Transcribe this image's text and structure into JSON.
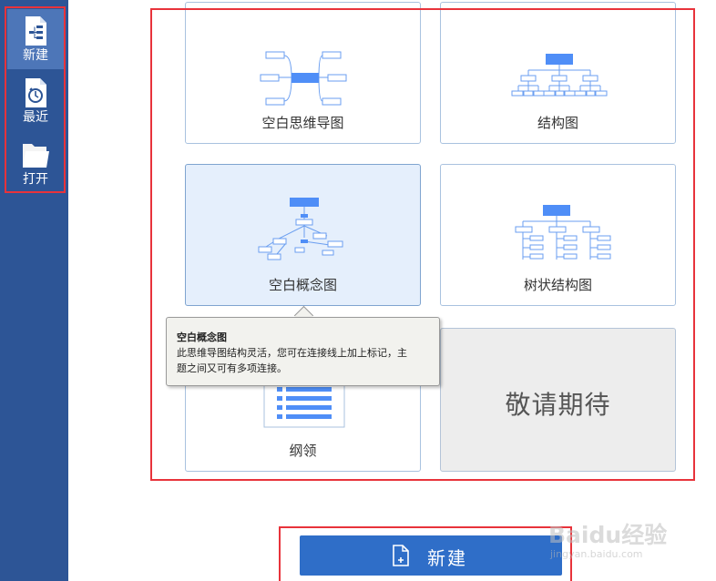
{
  "sidebar": {
    "items": [
      {
        "label": "新建",
        "icon": "new-file-icon"
      },
      {
        "label": "最近",
        "icon": "recent-clock-icon"
      },
      {
        "label": "打开",
        "icon": "open-folder-icon"
      }
    ]
  },
  "templates": [
    {
      "label": "空白思维导图",
      "icon": "mind-map-thumbnail"
    },
    {
      "label": "结构图",
      "icon": "org-chart-thumbnail"
    },
    {
      "label": "空白概念图",
      "icon": "concept-map-thumbnail"
    },
    {
      "label": "树状结构图",
      "icon": "tree-chart-thumbnail"
    },
    {
      "label": "纲领",
      "icon": "outline-thumbnail"
    },
    {
      "label": "敬请期待",
      "icon": ""
    }
  ],
  "tooltip": {
    "title": "空白概念图",
    "line1": "此思维导图结构灵活，您可在连接线上加上标记，主",
    "line2": "题之间又可有多项连接。"
  },
  "new_button": {
    "label": "新建",
    "icon": "new-file-icon"
  },
  "watermark": {
    "main": "Baidu经验",
    "sub": "jingyan.baidu.com"
  },
  "colors": {
    "sidebar_bg": "#2d5596",
    "sidebar_active": "#4d76b8",
    "highlight_red": "#e8333b",
    "button_blue": "#2f6ec8",
    "thumbnail_blue": "#6a9ef0"
  }
}
